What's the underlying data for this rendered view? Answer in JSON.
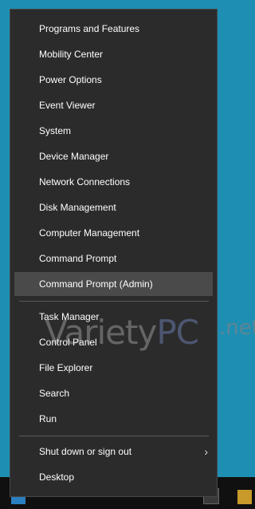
{
  "menu": {
    "items": [
      {
        "label": "Programs and Features"
      },
      {
        "label": "Mobility Center"
      },
      {
        "label": "Power Options"
      },
      {
        "label": "Event Viewer"
      },
      {
        "label": "System"
      },
      {
        "label": "Device Manager"
      },
      {
        "label": "Network Connections"
      },
      {
        "label": "Disk Management"
      },
      {
        "label": "Computer Management"
      },
      {
        "label": "Command Prompt"
      },
      {
        "label": "Command Prompt (Admin)",
        "highlighted": true
      },
      {
        "label": "Task Manager"
      },
      {
        "label": "Control Panel"
      },
      {
        "label": "File Explorer"
      },
      {
        "label": "Search"
      },
      {
        "label": "Run"
      },
      {
        "label": "Shut down or sign out",
        "submenu": true
      },
      {
        "label": "Desktop"
      }
    ],
    "submenu_icon": "chevron-right-icon"
  },
  "watermark": {
    "part1": "Variety",
    "part2": "PC",
    "part3": ".net"
  },
  "colors": {
    "desktop": "#1e8fb3",
    "menu_background": "#2b2b2b",
    "highlight": "#4a4a4a",
    "text": "#ffffff"
  }
}
